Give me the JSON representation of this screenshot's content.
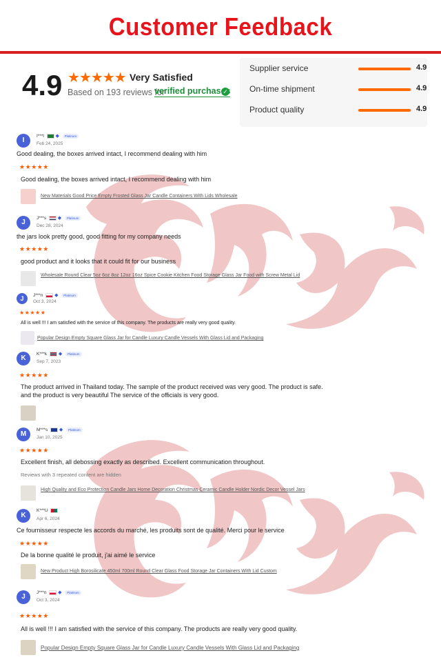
{
  "header": {
    "title": "Customer Feedback"
  },
  "summary": {
    "score": "4.9",
    "stars": "★★★★★",
    "rating_label": "Very Satisfied",
    "based_on": "Based on 193 reviews for",
    "verified": "verified purchases",
    "verified_icon": "check-circle-icon",
    "metrics": [
      {
        "label": "Supplier service",
        "value": "4.9",
        "fraction": 0.98
      },
      {
        "label": "On-time shipment",
        "value": "4.9",
        "fraction": 0.98
      },
      {
        "label": "Product quality",
        "value": "4.9",
        "fraction": 0.98
      }
    ]
  },
  "colors": {
    "title": "#e8141b",
    "accent": "#ff6a00",
    "verified": "#1d8f3a",
    "avatar": "#4a62d8",
    "watermark": "#d14545"
  },
  "reviews": [
    {
      "initial": "I",
      "name": "I***l",
      "badge": "Platinum",
      "date": "Feb 24, 2025",
      "comment": "Good dealing, the boxes arrived intact, I recommend dealing with him",
      "stars": "★★★★★",
      "text": "Good dealing, the boxes arrived intact, I recommend dealing with him",
      "note": "",
      "product": "New Materials Good Price Empty Frosted Glass Jar Candle Containers With Lids Wholesale"
    },
    {
      "initial": "J",
      "name": "J***s",
      "badge": "Platinum",
      "date": "Dec 28, 2024",
      "comment": "the jars look pretty good, good fitting for my company needs",
      "stars": "★★★★★",
      "text": "good product and it looks that it could fit for our business",
      "note": "",
      "product": "Wholesale Round Clear 5oz 6oz 8oz 12oz 16oz Spice Cookie Kitchen Food Storage Glass Jar Food with Screw Metal Lid"
    },
    {
      "initial": "J",
      "name": "J***n",
      "badge": "Platinum",
      "date": "Oct 3, 2024",
      "comment": "",
      "stars": "★★★★★",
      "text": "All is well !!! I am satisfied with the service of this company. The products are really very good quality.",
      "note": "",
      "product": "Popular Design Empty Square Glass Jar for Candle Luxury Candle Vessels With Glass Lid and Packaging"
    },
    {
      "initial": "K",
      "name": "K***k",
      "badge": "Platinum",
      "date": "Sep 7, 2023",
      "comment": "",
      "stars": "★★★★★",
      "text": "The product arrived in Thailand today. The sample of the product received was very good. The product is safe. and the product is very beautiful The service of the officials is very good.",
      "note": "",
      "product": ""
    },
    {
      "initial": "M",
      "name": "M***s",
      "badge": "Platinum",
      "date": "Jan 10, 2025",
      "comment": "",
      "stars": "★★★★★",
      "text": "Excellent finish, all debossing exactly as described. Excellent communication throughout.",
      "note": "Reviews with 3 repeated content are hidden",
      "product": "High Quality and Eco Protection Candle Jars Home Decoration Christmas Ceramic Candle Holder Nordic Decor Vessel Jars"
    },
    {
      "initial": "K",
      "name": "K***U",
      "badge": "",
      "date": "Apr 6, 2024",
      "comment": "Ce fournisseur respecte les accords du marché, les produits sont de qualité. Merci pour le service",
      "stars": "★★★★★",
      "text": "De la bonne qualité le produit, j'ai aimé le service",
      "note": "",
      "product": "New Product High Borosilicate 450ml 700ml Round Clear Glass Food Storage Jar Containers With Lid Custom"
    },
    {
      "initial": "J",
      "name": "J***n",
      "badge": "Platinum",
      "date": "Oct 3, 2024",
      "comment": "",
      "stars": "★★★★★",
      "text": "All is well !!! I am satisfied with the service of this company. The products are really very good quality.",
      "note": "",
      "product": "Popular Design Empty Square Glass Jar for Candle Luxury Candle Vessels With Glass Lid and Packaging"
    }
  ]
}
